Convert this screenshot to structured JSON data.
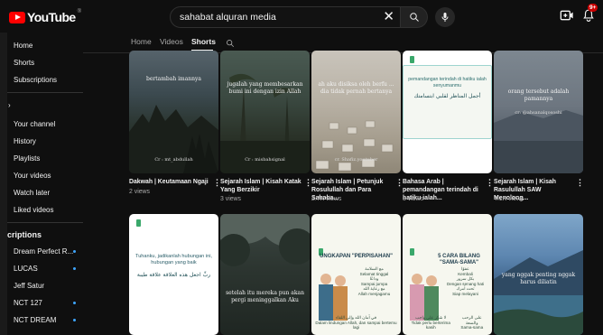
{
  "header": {
    "logo_text": "YouTube",
    "logo_region": "®",
    "search_value": "sahabat alquran media",
    "notification_count": "9+"
  },
  "sidebar": {
    "items_top": [
      "Home",
      "Shorts",
      "Subscriptions"
    ],
    "you_section_chevron": "›",
    "items_you": [
      "Your channel",
      "History",
      "Playlists",
      "Your videos",
      "Watch later",
      "Liked videos"
    ],
    "subscriptions_heading": "criptions",
    "subscriptions": [
      "Dream Perfect R...",
      "LUCAS",
      "Jeff Satur",
      "NCT 127",
      "NCT DREAM"
    ]
  },
  "tabs": [
    "Home",
    "Videos",
    "Shorts"
  ],
  "shorts": [
    {
      "title": "Dakwah | Keutamaan Ngaji",
      "views": "2 views",
      "overlay": "bertambah imannya",
      "credit": "Cr : mt_abdullah"
    },
    {
      "title": "Sejarah Islam | Kisah Katak Yang Berzikir",
      "views": "3 views",
      "overlay": "jugalah yang membesarkan bumi ini dengan izin Allah",
      "credit": "Cr : misbahsignal"
    },
    {
      "title": "Sejarah Islam | Petunjuk Rosulullah dan Para Sahaba...",
      "views": "2.7K views",
      "overlay": "ah aku disiksa oleh berfu ... dia tidak pernah bertanya",
      "credit": "cr. Shafiz.youtuber"
    },
    {
      "title": "Bahasa Arab | pemandangan terindah di hatiku ialah...",
      "views": "3 views",
      "overlay": "pemandangan terindah di hatiku ialah senyumanmu",
      "arabic": "أجمل المناظر لقلبي ابتسامتك"
    },
    {
      "title": "Sejarah Islam | Kisah Rasulullah SAW Menolong...",
      "views": "4.1K views",
      "overlay": "orang tersebut adalah pamannya",
      "credit": "cr: @ahsanalqososhi"
    }
  ],
  "shorts_row2": [
    {
      "overlay": "Tuhanku, jadikanlah hubungan ini, hubungan yang baik",
      "arabic": "ربِّ اجعل هذه العلاقة علاقة طيبة"
    },
    {
      "overlay": "setelah itu mereka pun akan pergi meninggalkan Aku"
    },
    {
      "overlay": "UNGKAPAN \"PERPISAHAN\"",
      "labels": [
        "مع السلامة",
        "Selamat tinggal",
        "وداعًا",
        "Sampai jumpa",
        "مع رعاية الله",
        "Allah menjagamu",
        "في أمان الله وإلى اللقاء",
        "Dalam lindungan Allah, dan sampai bertemu lagi"
      ]
    },
    {
      "overlay": "5 CARA BILANG \"SAMA-SAMA\"",
      "labels": [
        "عفوًا",
        "Kembali",
        "بكل سرور",
        "Dengan senang hati",
        "تحت أمرك",
        "Siap melayani",
        "لا شكر على واجب",
        "Tidak perlu berterima kasih",
        "على الرحب والسعة",
        "Sama-sama"
      ]
    },
    {
      "overlay": "yang nggak penting nggak harus diliatin"
    }
  ],
  "colors": {
    "accent": "#ff0000",
    "background": "#0f0f0f",
    "link_dot": "#3ea6ff"
  }
}
